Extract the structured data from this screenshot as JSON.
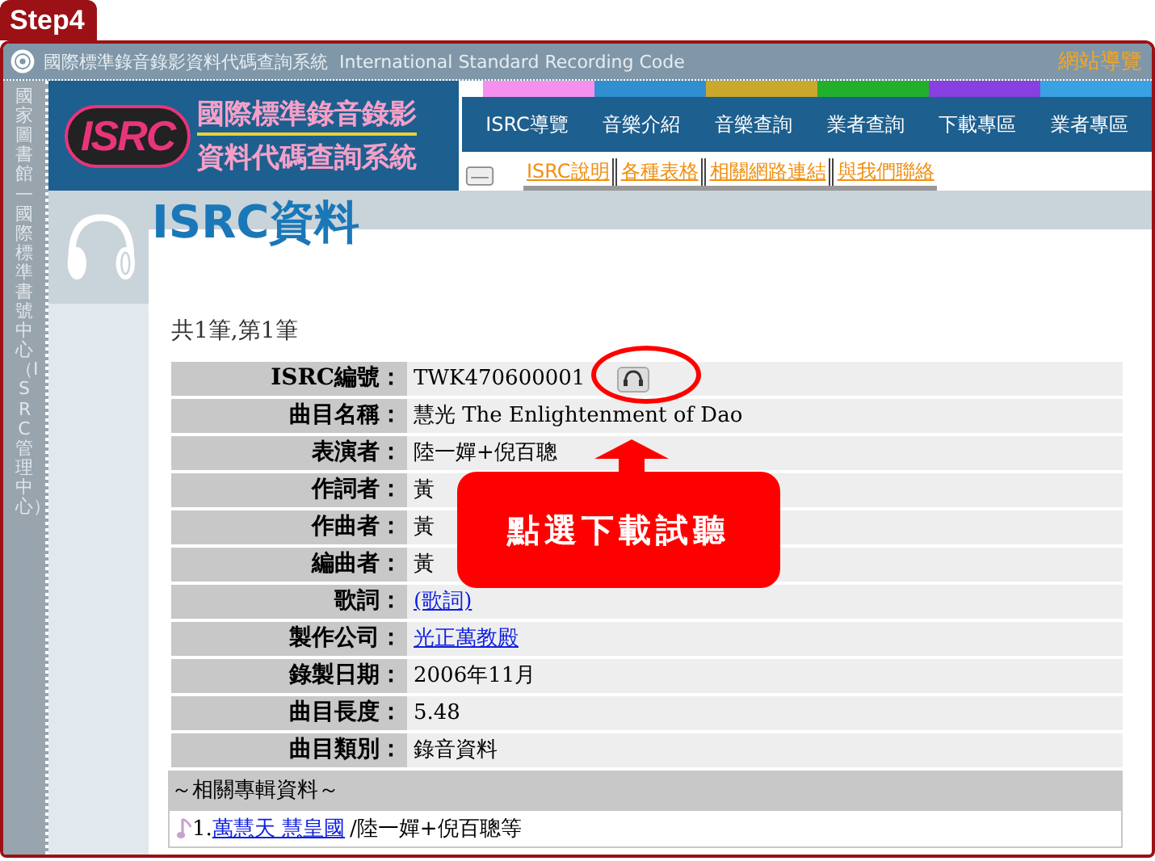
{
  "step_tab": "Step4",
  "top_bar": {
    "title": "國際標準錄音錄影資料代碼查詢系統  International Standard Recording Code",
    "site_map": "網站導覽"
  },
  "sidebar": {
    "text": "國家圖書館—國際標準書號中心（ISRC管理中心）"
  },
  "logo": {
    "mark": "ISRC",
    "line_1": "國際標準錄音錄影",
    "line_2": "資料代碼查詢系統"
  },
  "nav": [
    {
      "label": "ISRC導覽",
      "color": "#f590ee"
    },
    {
      "label": "音樂介紹",
      "color": "#2f8fd0"
    },
    {
      "label": "音樂查詢",
      "color": "#c9a82c"
    },
    {
      "label": "業者查詢",
      "color": "#22b02c"
    },
    {
      "label": "下載專區",
      "color": "#8840e0"
    },
    {
      "label": "業者專區",
      "color": "#3aa2e2"
    }
  ],
  "sub_links": [
    "ISRC說明",
    "各種表格",
    "相關網路連結",
    "與我們聯絡"
  ],
  "page_title": "ISRC資料",
  "result_count": "共1筆,第1筆",
  "details": [
    {
      "kind": "code",
      "label": "ISRC編號：",
      "value": "TWK470600001"
    },
    {
      "kind": "text",
      "label": "曲目名稱：",
      "value": "慧光 The Enlightenment of Dao"
    },
    {
      "kind": "text",
      "label": "表演者：",
      "value": "陸一嬋+倪百聰"
    },
    {
      "kind": "text",
      "label": "作詞者：",
      "value": "黃"
    },
    {
      "kind": "text",
      "label": "作曲者：",
      "value": "黃"
    },
    {
      "kind": "text",
      "label": "編曲者：",
      "value": "黃"
    },
    {
      "kind": "link",
      "label": "歌詞：",
      "value": "(歌詞)"
    },
    {
      "kind": "link",
      "label": "製作公司：",
      "value": "光正萬教殿"
    },
    {
      "kind": "text",
      "label": "錄製日期：",
      "value": "2006年11月"
    },
    {
      "kind": "text",
      "label": "曲目長度：",
      "value": "5.48"
    },
    {
      "kind": "text",
      "label": "曲目類別：",
      "value": "錄音資料"
    }
  ],
  "albums": {
    "heading": "～相關專輯資料～",
    "items": [
      {
        "number": "1.",
        "title": "萬慧天 慧皇國",
        "artists": "/陸一嬋+倪百聰等"
      }
    ]
  },
  "callout": {
    "text": "點選下載試聽"
  }
}
